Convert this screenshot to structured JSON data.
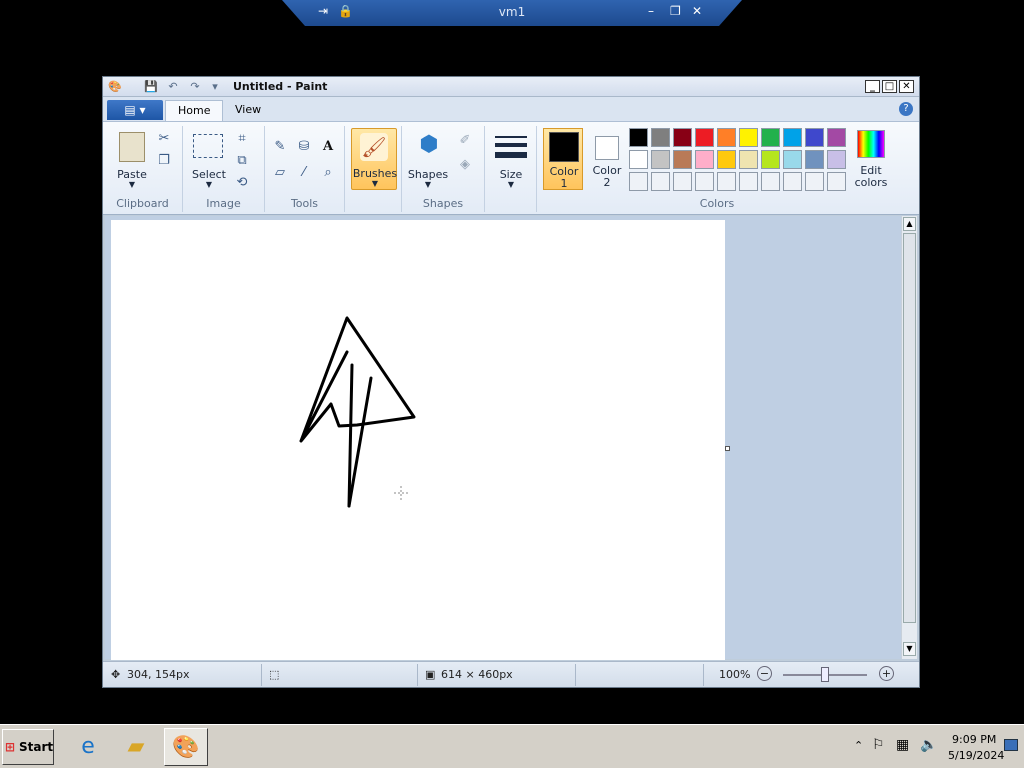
{
  "remote_bar": {
    "title": "vm1"
  },
  "window": {
    "title": "Untitled - Paint"
  },
  "tabs": [
    {
      "label": "Home"
    },
    {
      "label": "View"
    }
  ],
  "ribbon": {
    "clipboard": {
      "paste": "Paste",
      "group": "Clipboard"
    },
    "image": {
      "select": "Select",
      "group": "Image"
    },
    "tools": {
      "group": "Tools"
    },
    "brushes": {
      "label": "Brushes"
    },
    "shapes": {
      "label": "Shapes",
      "group": "Shapes"
    },
    "size": {
      "label": "Size"
    },
    "color1": {
      "label1": "Color",
      "label2": "1"
    },
    "color2": {
      "label1": "Color",
      "label2": "2"
    },
    "colors_group": "Colors",
    "edit_colors": {
      "label1": "Edit",
      "label2": "colors"
    }
  },
  "palette_row1": [
    "#000000",
    "#7f7f7f",
    "#880015",
    "#ed1c24",
    "#ff7f27",
    "#fff200",
    "#22b14c",
    "#00a2e8",
    "#3f48cc",
    "#a349a4"
  ],
  "palette_row2": [
    "#ffffff",
    "#c3c3c3",
    "#b97a57",
    "#ffaec9",
    "#ffc90e",
    "#efe4b0",
    "#b5e61d",
    "#99d9ea",
    "#7092be",
    "#c8bfe7"
  ],
  "status": {
    "cursor_pos": "304, 154px",
    "canvas_size": "614 × 460px",
    "zoom": "100%"
  },
  "taskbar": {
    "start": "Start",
    "time": "9:09 PM",
    "date": "5/19/2024"
  }
}
